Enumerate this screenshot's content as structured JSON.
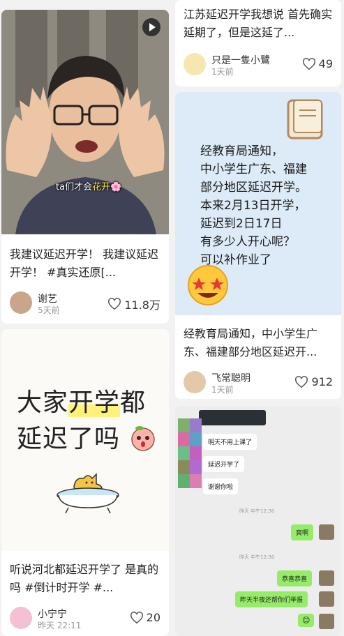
{
  "cards": [
    {
      "caption_prefix": "ta们才会",
      "caption_highlight": "花开",
      "title": "我建议延迟开学！ 我建议延迟开学！ #真实还原[...",
      "user": "谢艺",
      "time": "5天前",
      "likes": "11.8万"
    },
    {
      "title": "江苏延迟开学我想说 首先确实延期了，但是这延了...",
      "user": "只是一隻小鷺",
      "time": "1天前",
      "likes": "49"
    },
    {
      "notice": "经教育局通知，\n中小学生广东、福建\n部分地区延迟开学。\n本来2月13日开学，\n延迟到2日17日\n有多少人开心呢？\n可以补作业了",
      "title": "经教育局通知，中小学生广东、福建部分地区延迟开...",
      "user": "飞常聪明",
      "time": "1天前",
      "likes": "912"
    },
    {
      "big_line1_a": "大家",
      "big_line1_hl": "开学",
      "big_line1_b": "都",
      "big_line2": "延迟了吗",
      "title": "听说河北都延迟开学了 是真的吗 #倒计时开学 #...",
      "user": "小宁宁",
      "time": "昨天 22:11",
      "likes": "20"
    },
    {
      "chat": {
        "msg1": "明天不用上课了",
        "msg2": "延迟开学了",
        "msg3": "谢谢你啦",
        "time1": "昨天 中午12:30",
        "reply1": "爽啊",
        "time2": "昨天 中午12:30",
        "reply2": "恭喜恭喜",
        "reply3": "昨天半夜还帮你们举报"
      }
    }
  ],
  "colors": {
    "card_bg": "#ffffff",
    "page_bg": "#f2f2f2",
    "notice_bg": "#dcebf7",
    "chat_bubble": "#95ec69"
  },
  "icons": [
    "play-icon",
    "heart-icon",
    "book-icon",
    "star-struck-emoji",
    "peach-emoji",
    "cat-bathtub-illustration"
  ]
}
